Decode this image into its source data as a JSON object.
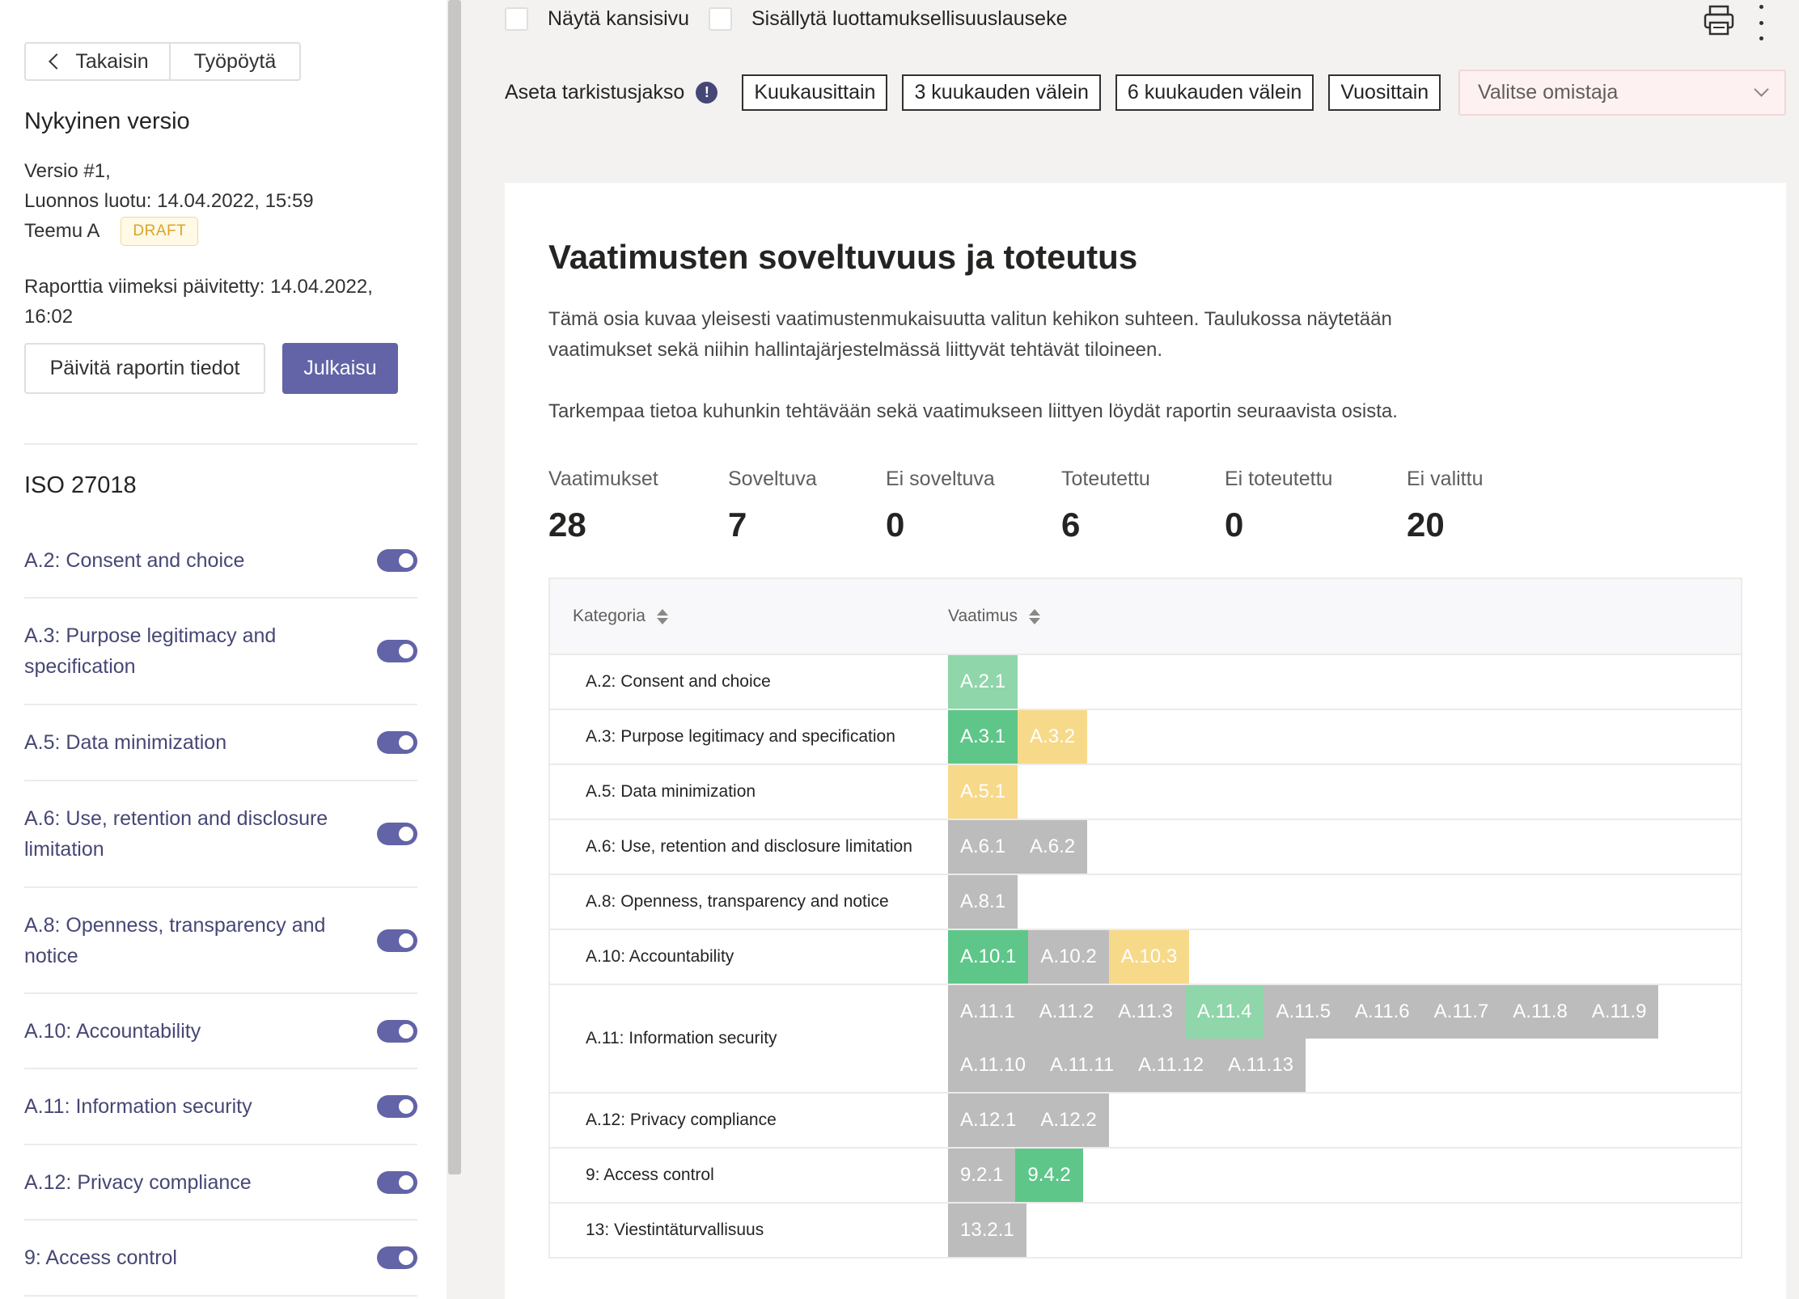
{
  "sidebar": {
    "back_label": "Takaisin",
    "desk_label": "Työpöytä",
    "heading": "Nykyinen versio",
    "version": "Versio #1,",
    "draft_created": "Luonnos luotu: 14.04.2022, 15:59",
    "owner": "Teemu A",
    "status_badge": "DRAFT",
    "updated": "Raporttia viimeksi päivitetty: 14.04.2022, 16:02",
    "update_button": "Päivitä raportin tiedot",
    "publish_button": "Julkaisu",
    "framework": "ISO 27018",
    "sections": [
      {
        "label": "A.2: Consent and choice",
        "enabled": true
      },
      {
        "label": "A.3: Purpose legitimacy and specification",
        "enabled": true
      },
      {
        "label": "A.5: Data minimization",
        "enabled": true
      },
      {
        "label": "A.6: Use, retention and disclosure limitation",
        "enabled": true
      },
      {
        "label": "A.8: Openness, transparency and notice",
        "enabled": true
      },
      {
        "label": "A.10: Accountability",
        "enabled": true
      },
      {
        "label": "A.11: Information security",
        "enabled": true
      },
      {
        "label": "A.12: Privacy compliance",
        "enabled": true
      },
      {
        "label": "9: Access control",
        "enabled": true
      }
    ]
  },
  "toolbar": {
    "show_cover_label": "Näytä kansisivu",
    "include_confidentiality_label": "Sisällytä luottamuksellisuuslauseke",
    "print_icon": "print-icon",
    "more_icon": "more-vertical-icon"
  },
  "review": {
    "label": "Aseta tarkistusjakso",
    "options": [
      "Kuukausittain",
      "3 kuukauden välein",
      "6 kuukauden välein",
      "Vuosittain"
    ],
    "owner_placeholder": "Valitse omistaja"
  },
  "card": {
    "title": "Vaatimusten soveltuvuus ja toteutus",
    "desc1": "Tämä osia kuvaa yleisesti vaatimustenmukaisuutta valitun kehikon suhteen. Taulukossa näytetään vaatimukset sekä niihin hallintajärjestelmässä liittyvät tehtävät tiloineen.",
    "desc2": "Tarkempaa tietoa kuhunkin tehtävään sekä vaatimukseen liittyen löydät raportin seuraavista osista."
  },
  "stats": [
    {
      "label": "Vaatimukset",
      "value": "28"
    },
    {
      "label": "Soveltuva",
      "value": "7"
    },
    {
      "label": "Ei soveltuva",
      "value": "0"
    },
    {
      "label": "Toteutettu",
      "value": "6"
    },
    {
      "label": "Ei toteutettu",
      "value": "0"
    },
    {
      "label": "Ei valittu",
      "value": "20"
    }
  ],
  "table": {
    "col_category": "Kategoria",
    "col_requirement": "Vaatimus",
    "rows": [
      {
        "category": "A.2: Consent and choice",
        "chips": [
          {
            "id": "A.2.1",
            "status": "lightgreen"
          }
        ]
      },
      {
        "category": "A.3: Purpose legitimacy and specification",
        "chips": [
          {
            "id": "A.3.1",
            "status": "green"
          },
          {
            "id": "A.3.2",
            "status": "yellow"
          }
        ]
      },
      {
        "category": "A.5: Data minimization",
        "chips": [
          {
            "id": "A.5.1",
            "status": "yellow"
          }
        ]
      },
      {
        "category": "A.6: Use, retention and disclosure limitation",
        "chips": [
          {
            "id": "A.6.1",
            "status": "grey"
          },
          {
            "id": "A.6.2",
            "status": "grey"
          }
        ]
      },
      {
        "category": "A.8: Openness, transparency and notice",
        "chips": [
          {
            "id": "A.8.1",
            "status": "grey"
          }
        ]
      },
      {
        "category": "A.10: Accountability",
        "chips": [
          {
            "id": "A.10.1",
            "status": "green"
          },
          {
            "id": "A.10.2",
            "status": "grey"
          },
          {
            "id": "A.10.3",
            "status": "yellow"
          }
        ]
      },
      {
        "category": "A.11: Information security",
        "chips": [
          {
            "id": "A.11.1",
            "status": "grey"
          },
          {
            "id": "A.11.2",
            "status": "grey"
          },
          {
            "id": "A.11.3",
            "status": "grey"
          },
          {
            "id": "A.11.4",
            "status": "lightgreen"
          },
          {
            "id": "A.11.5",
            "status": "grey"
          },
          {
            "id": "A.11.6",
            "status": "grey"
          },
          {
            "id": "A.11.7",
            "status": "grey"
          },
          {
            "id": "A.11.8",
            "status": "grey"
          },
          {
            "id": "A.11.9",
            "status": "grey"
          },
          {
            "id": "A.11.10",
            "status": "grey"
          },
          {
            "id": "A.11.11",
            "status": "grey"
          },
          {
            "id": "A.11.12",
            "status": "grey"
          },
          {
            "id": "A.11.13",
            "status": "grey"
          }
        ]
      },
      {
        "category": "A.12: Privacy compliance",
        "chips": [
          {
            "id": "A.12.1",
            "status": "grey"
          },
          {
            "id": "A.12.2",
            "status": "grey"
          }
        ]
      },
      {
        "category": "9: Access control",
        "chips": [
          {
            "id": "9.2.1",
            "status": "grey"
          },
          {
            "id": "9.4.2",
            "status": "green"
          }
        ]
      },
      {
        "category": "13: Viestintäturvallisuus",
        "chips": [
          {
            "id": "13.2.1",
            "status": "grey"
          }
        ]
      }
    ]
  },
  "colors": {
    "accent": "#6264a7",
    "implemented": "#5fc68a",
    "applicable": "#8fd6aa",
    "in_progress": "#f7d98a",
    "not_selected": "#bcbcbc"
  }
}
